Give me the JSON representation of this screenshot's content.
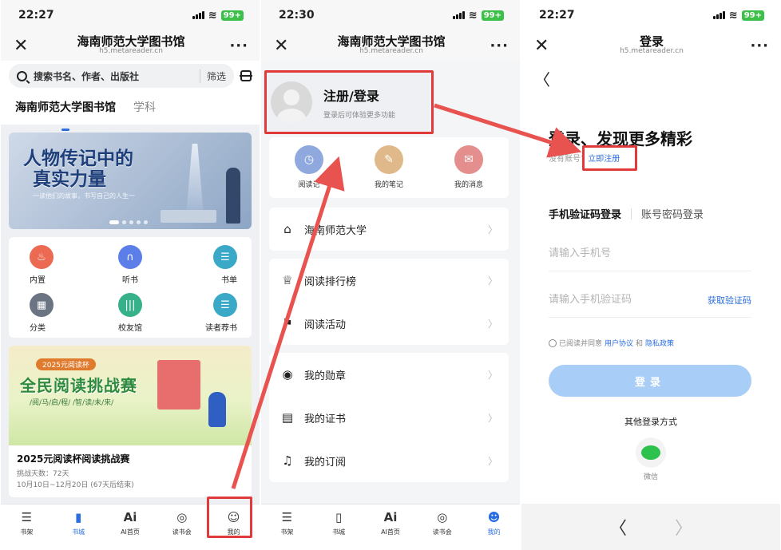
{
  "panel1": {
    "status": {
      "time": "22:27",
      "battery": "99+"
    },
    "titlebar": {
      "title": "海南师范大学图书馆",
      "url": "h5.metareader.cn"
    },
    "search": {
      "placeholder": "搜索书名、作者、出版社",
      "filter": "筛选"
    },
    "tabs": [
      "海南师范大学图书馆",
      "学科"
    ],
    "banner": {
      "title_line1": "人物传记中的",
      "title_line2": "真实力量",
      "subtitle": "一读他们的故事，书写自己的人生一"
    },
    "grid": [
      {
        "label": "内置",
        "icon": "fire-icon",
        "color": "#ec6a52"
      },
      {
        "label": "听书",
        "icon": "headphones-icon",
        "color": "#5c7ee8"
      },
      {
        "label": "书单",
        "icon": "list-icon",
        "color": "#3aa9c8"
      },
      {
        "label": "分类",
        "icon": "category-icon",
        "color": "#6b7482"
      },
      {
        "label": "校友馆",
        "icon": "bookshelf-icon",
        "color": "#36b18a"
      },
      {
        "label": "读者荐书",
        "icon": "recommend-icon",
        "color": "#3aa9c8"
      }
    ],
    "promo": {
      "tag": "2025元阅读杯",
      "headline": "全民阅读挑战赛",
      "slogan": "/阅/马/启/程/ /智/读/未/来/",
      "title": "2025元阅读杯阅读挑战赛",
      "days": "挑战天数：72天",
      "dates": "10月10日~12月20日 (67天后结束)"
    },
    "tabbar": [
      {
        "label": "书架",
        "icon": "bookshelf-tab-icon"
      },
      {
        "label": "书城",
        "icon": "book-tab-icon",
        "active": true
      },
      {
        "label": "AI首页",
        "icon": "ai-tab-icon"
      },
      {
        "label": "读书会",
        "icon": "planet-tab-icon"
      },
      {
        "label": "我的",
        "icon": "user-tab-icon"
      }
    ]
  },
  "panel2": {
    "status": {
      "time": "22:30",
      "battery": "99+"
    },
    "titlebar": {
      "title": "海南师范大学图书馆",
      "url": "h5.metareader.cn"
    },
    "profile": {
      "name": "注册/登录",
      "subtitle": "登录后可体验更多功能"
    },
    "features": [
      {
        "label": "阅读记",
        "icon": "clock-icon",
        "color": "#8fa9de"
      },
      {
        "label": "我的笔记",
        "icon": "leaf-icon",
        "color": "#e0b98a"
      },
      {
        "label": "我的消息",
        "icon": "message-icon",
        "color": "#e48e8e"
      }
    ],
    "menu_groups": [
      [
        {
          "label": "海南师范大学",
          "icon": "building-icon"
        }
      ],
      [
        {
          "label": "阅读排行榜",
          "icon": "trophy-icon"
        },
        {
          "label": "阅读活动",
          "icon": "flag-icon"
        }
      ],
      [
        {
          "label": "我的勋章",
          "icon": "medal-icon"
        },
        {
          "label": "我的证书",
          "icon": "certificate-icon"
        },
        {
          "label": "我的订阅",
          "icon": "bell-icon"
        }
      ]
    ],
    "tabbar": [
      {
        "label": "书架",
        "icon": "bookshelf-tab-icon"
      },
      {
        "label": "书城",
        "icon": "book-tab-icon"
      },
      {
        "label": "AI首页",
        "icon": "ai-tab-icon"
      },
      {
        "label": "读书会",
        "icon": "planet-tab-icon"
      },
      {
        "label": "我的",
        "icon": "user-tab-icon",
        "active": true
      }
    ]
  },
  "panel3": {
    "status": {
      "time": "22:27",
      "battery": "99+"
    },
    "titlebar": {
      "title": "登录",
      "url": "h5.metareader.cn"
    },
    "headline": "登录、发现更多精彩",
    "no_account": "没有账号?",
    "register": "立即注册",
    "tabs": {
      "active": "手机验证码登录",
      "other": "账号密码登录"
    },
    "phone_placeholder": "请输入手机号",
    "code_placeholder": "请输入手机验证码",
    "get_code": "获取验证码",
    "agree": {
      "prefix": "已阅读并同意",
      "user_agreement": "用户协议",
      "and": "和",
      "privacy": "隐私政策"
    },
    "login_button": "登录",
    "other_methods": "其他登录方式",
    "wechat": "微信"
  },
  "colors": {
    "accent": "#2a6ee0",
    "highlight": "#e03a3a"
  }
}
